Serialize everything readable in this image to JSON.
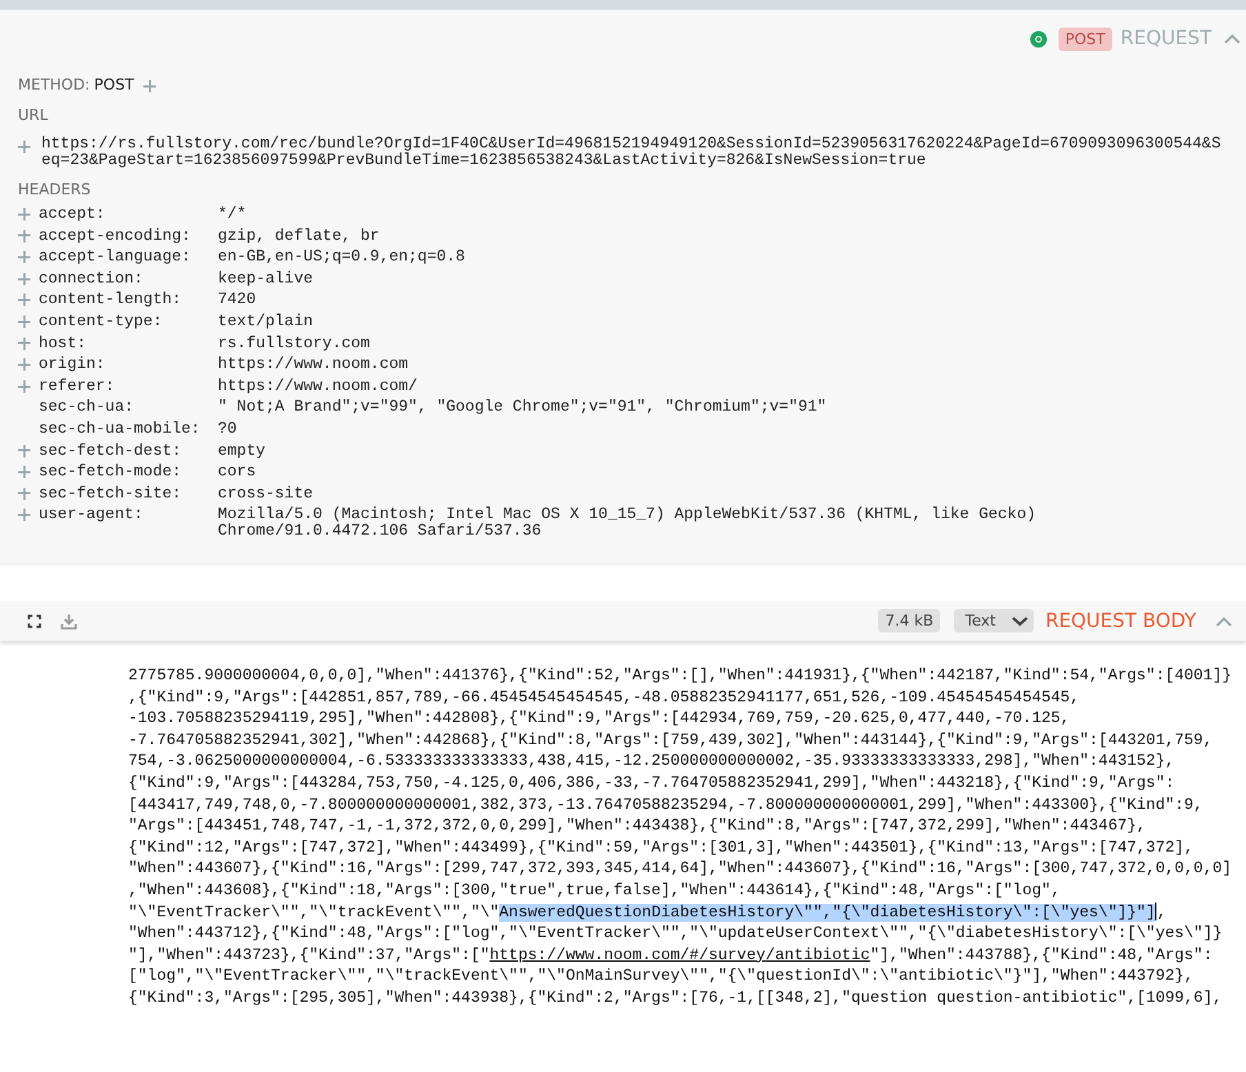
{
  "request": {
    "method_badge": "POST",
    "title": "REQUEST",
    "method_label": "METHOD:",
    "method": "POST",
    "url_label": "URL",
    "url": "https://rs.fullstory.com/rec/bundle?OrgId=1F40C&UserId=4968152194949120&SessionId=5239056317620224&PageId=6709093096300544&Seq=23&PageStart=1623856097599&PrevBundleTime=1623856538243&LastActivity=826&IsNewSession=true",
    "headers_label": "HEADERS",
    "headers": [
      {
        "name": "accept:",
        "value": "*/*",
        "addable": true
      },
      {
        "name": "accept-encoding:",
        "value": "gzip, deflate, br",
        "addable": true
      },
      {
        "name": "accept-language:",
        "value": "en-GB,en-US;q=0.9,en;q=0.8",
        "addable": true
      },
      {
        "name": "connection:",
        "value": "keep-alive",
        "addable": true
      },
      {
        "name": "content-length:",
        "value": "7420",
        "addable": true
      },
      {
        "name": "content-type:",
        "value": "text/plain",
        "addable": true
      },
      {
        "name": "host:",
        "value": "rs.fullstory.com",
        "addable": true
      },
      {
        "name": "origin:",
        "value": "https://www.noom.com",
        "addable": true
      },
      {
        "name": "referer:",
        "value": "https://www.noom.com/",
        "addable": true
      },
      {
        "name": "sec-ch-ua:",
        "value": "\" Not;A Brand\";v=\"99\", \"Google Chrome\";v=\"91\", \"Chromium\";v=\"91\"",
        "addable": false
      },
      {
        "name": "sec-ch-ua-mobile:",
        "value": "?0",
        "addable": false
      },
      {
        "name": "sec-fetch-dest:",
        "value": "empty",
        "addable": true
      },
      {
        "name": "sec-fetch-mode:",
        "value": "cors",
        "addable": true
      },
      {
        "name": "sec-fetch-site:",
        "value": "cross-site",
        "addable": true
      },
      {
        "name": "user-agent:",
        "value": "Mozilla/5.0 (Macintosh; Intel Mac OS X 10_15_7) AppleWebKit/537.36 (KHTML, like Gecko) Chrome/91.0.4472.106 Safari/537.36",
        "addable": true
      }
    ]
  },
  "request_body": {
    "size": "7.4 kB",
    "format": "Text",
    "title": "REQUEST BODY",
    "lines": [
      [
        {
          "kind": "plain",
          "text": "2775785.9000000004,0,0,0],\"When\":441376},{\"Kind\":52,\"Args\":[],\"When\":441931},{\"When\":442187,\"Kind\":54,\"Args\":[4001]}"
        }
      ],
      [
        {
          "kind": "plain",
          "text": ",{\"Kind\":9,\"Args\":[442851,857,789,-66.45454545454545,-48.05882352941177,651,526,-109.45454545454545,"
        }
      ],
      [
        {
          "kind": "plain",
          "text": "-103.70588235294119,295],\"When\":442808},{\"Kind\":9,\"Args\":[442934,769,759,-20.625,0,477,440,-70.125,"
        }
      ],
      [
        {
          "kind": "plain",
          "text": "-7.764705882352941,302],\"When\":442868},{\"Kind\":8,\"Args\":[759,439,302],\"When\":443144},{\"Kind\":9,\"Args\":[443201,759,"
        }
      ],
      [
        {
          "kind": "plain",
          "text": "754,-3.0625000000000004,-6.533333333333333,438,415,-12.250000000000002,-35.93333333333333,298],\"When\":443152},"
        }
      ],
      [
        {
          "kind": "plain",
          "text": "{\"Kind\":9,\"Args\":[443284,753,750,-4.125,0,406,386,-33,-7.764705882352941,299],\"When\":443218},{\"Kind\":9,\"Args\":"
        }
      ],
      [
        {
          "kind": "plain",
          "text": "[443417,749,748,0,-7.800000000000001,382,373,-13.76470588235294,-7.800000000000001,299],\"When\":443300},{\"Kind\":9,"
        }
      ],
      [
        {
          "kind": "plain",
          "text": "\"Args\":[443451,748,747,-1,-1,372,372,0,0,299],\"When\":443438},{\"Kind\":8,\"Args\":[747,372,299],\"When\":443467},"
        }
      ],
      [
        {
          "kind": "plain",
          "text": "{\"Kind\":12,\"Args\":[747,372],\"When\":443499},{\"Kind\":59,\"Args\":[301,3],\"When\":443501},{\"Kind\":13,\"Args\":[747,372],"
        }
      ],
      [
        {
          "kind": "plain",
          "text": "\"When\":443607},{\"Kind\":16,\"Args\":[299,747,372,393,345,414,64],\"When\":443607},{\"Kind\":16,\"Args\":[300,747,372,0,0,0,0]"
        }
      ],
      [
        {
          "kind": "plain",
          "text": ",\"When\":443608},{\"Kind\":18,\"Args\":[300,\"true\",true,false],\"When\":443614},{\"Kind\":48,\"Args\":[\"log\","
        }
      ],
      [
        {
          "kind": "plain",
          "text": "\"\\\"EventTracker\\\"\",\"\\\"trackEvent\\\"\",\"\\\""
        },
        {
          "kind": "highlight",
          "text": "AnsweredQuestionDiabetesHistory\\\"\",\"{\\\"diabetesHistory\\\":[\\\"yes\\\"]}\"]"
        },
        {
          "kind": "cursor"
        },
        {
          "kind": "plain",
          "text": ","
        }
      ],
      [
        {
          "kind": "plain",
          "text": "\"When\":443712},{\"Kind\":48,\"Args\":[\"log\",\"\\\"EventTracker\\\"\",\"\\\"updateUserContext\\\"\",\"{\\\"diabetesHistory\\\":[\\\"yes\\\"]}"
        }
      ],
      [
        {
          "kind": "plain",
          "text": "\"],\"When\":443723},{\"Kind\":37,\"Args\":[\""
        },
        {
          "kind": "link",
          "text": "https://www.noom.com/#/survey/antibiotic"
        },
        {
          "kind": "plain",
          "text": "\"],\"When\":443788},{\"Kind\":48,\"Args\":"
        }
      ],
      [
        {
          "kind": "plain",
          "text": "[\"log\",\"\\\"EventTracker\\\"\",\"\\\"trackEvent\\\"\",\"\\\"OnMainSurvey\\\"\",\"{\\\"questionId\\\":\\\"antibiotic\\\"}\"],\"When\":443792},"
        }
      ],
      [
        {
          "kind": "plain",
          "text": "{\"Kind\":3,\"Args\":[295,305],\"When\":443938},{\"Kind\":2,\"Args\":[76,-1,[[348,2],\"question question-antibiotic\",[1099,6],"
        }
      ]
    ]
  }
}
